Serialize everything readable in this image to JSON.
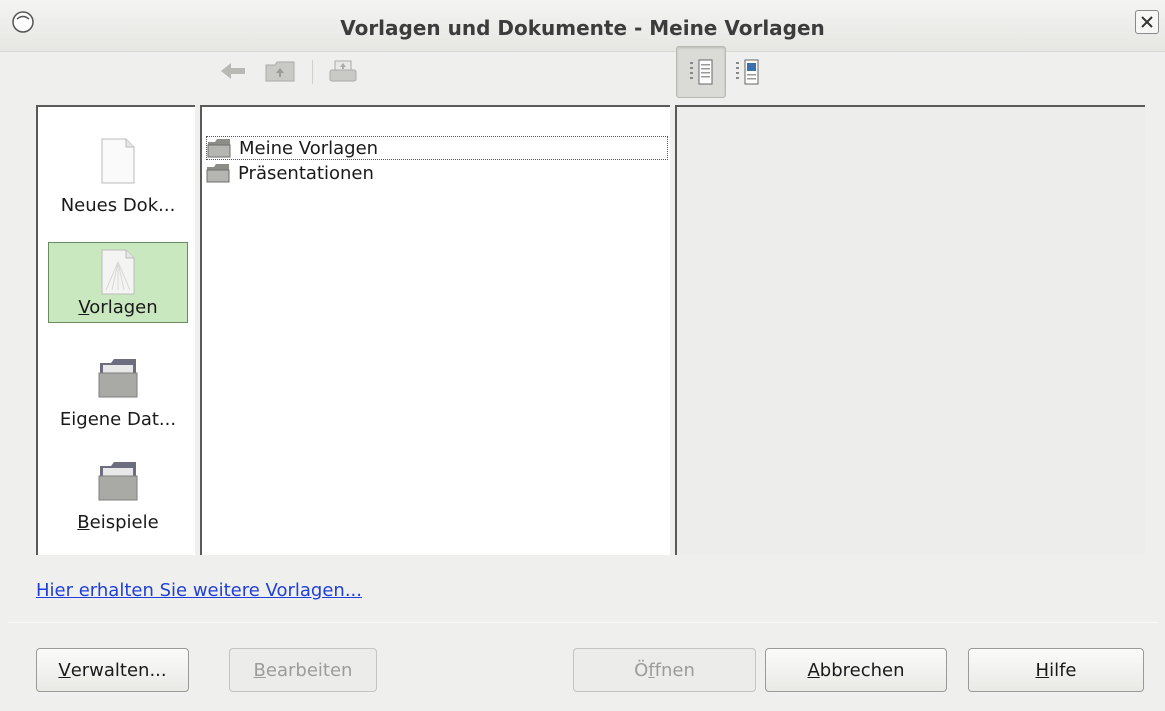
{
  "window": {
    "title": "Vorlagen und Dokumente - Meine Vorlagen"
  },
  "toolbar": {
    "icons": [
      "back-arrow-icon",
      "folder-up-icon",
      "print-icon",
      "document-properties-view-icon",
      "document-preview-view-icon"
    ]
  },
  "categories": [
    {
      "pre": "",
      "u": "",
      "post": "Neues Dok...",
      "icon": "new-document-icon"
    },
    {
      "pre": "",
      "u": "V",
      "post": "orlagen",
      "icon": "templates-icon",
      "selected": true
    },
    {
      "pre": "",
      "u": "",
      "post": "Eigene Dat...",
      "icon": "my-documents-folder-icon"
    },
    {
      "pre": "",
      "u": "B",
      "post": "eispiele",
      "icon": "samples-folder-icon"
    }
  ],
  "folders": [
    {
      "label": "Meine Vorlagen",
      "focused": true
    },
    {
      "label": "Präsentationen"
    }
  ],
  "link": {
    "label": "Hier erhalten Sie weitere Vorlagen..."
  },
  "buttons": {
    "verwalten": {
      "pre": "",
      "u": "V",
      "post": "erwalten..."
    },
    "bearbeiten": {
      "pre": "",
      "u": "B",
      "post": "earbeiten"
    },
    "oeffnen": {
      "pre": "Ö",
      "u": "f",
      "post": "fnen"
    },
    "abbrechen": {
      "pre": "",
      "u": "A",
      "post": "bbrechen"
    },
    "hilfe": {
      "pre": "",
      "u": "H",
      "post": "ilfe"
    }
  },
  "colors": {
    "selection": "#c9e8bf",
    "link": "#1f3fd6"
  }
}
